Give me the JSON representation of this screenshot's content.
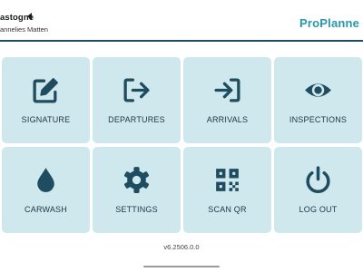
{
  "header": {
    "title": "astogne",
    "subtitle": "annelies Matten",
    "brand": "ProPlanne"
  },
  "tiles": [
    {
      "label": "SIGNATURE",
      "icon": "edit-icon"
    },
    {
      "label": "DEPARTURES",
      "icon": "logout-arrow-icon"
    },
    {
      "label": "ARRIVALS",
      "icon": "login-arrow-icon"
    },
    {
      "label": "INSPECTIONS",
      "icon": "eye-icon"
    },
    {
      "label": "CARWASH",
      "icon": "drop-icon"
    },
    {
      "label": "SETTINGS",
      "icon": "gear-icon"
    },
    {
      "label": "SCAN QR",
      "icon": "qr-code-icon"
    },
    {
      "label": "LOG OUT",
      "icon": "power-icon"
    }
  ],
  "version": "v6.2506.0.0",
  "colors": {
    "brand": "#2797b1",
    "tile": "#cfe8ee",
    "icon": "#1f4d5f",
    "header_line": "#1f4d5f"
  }
}
